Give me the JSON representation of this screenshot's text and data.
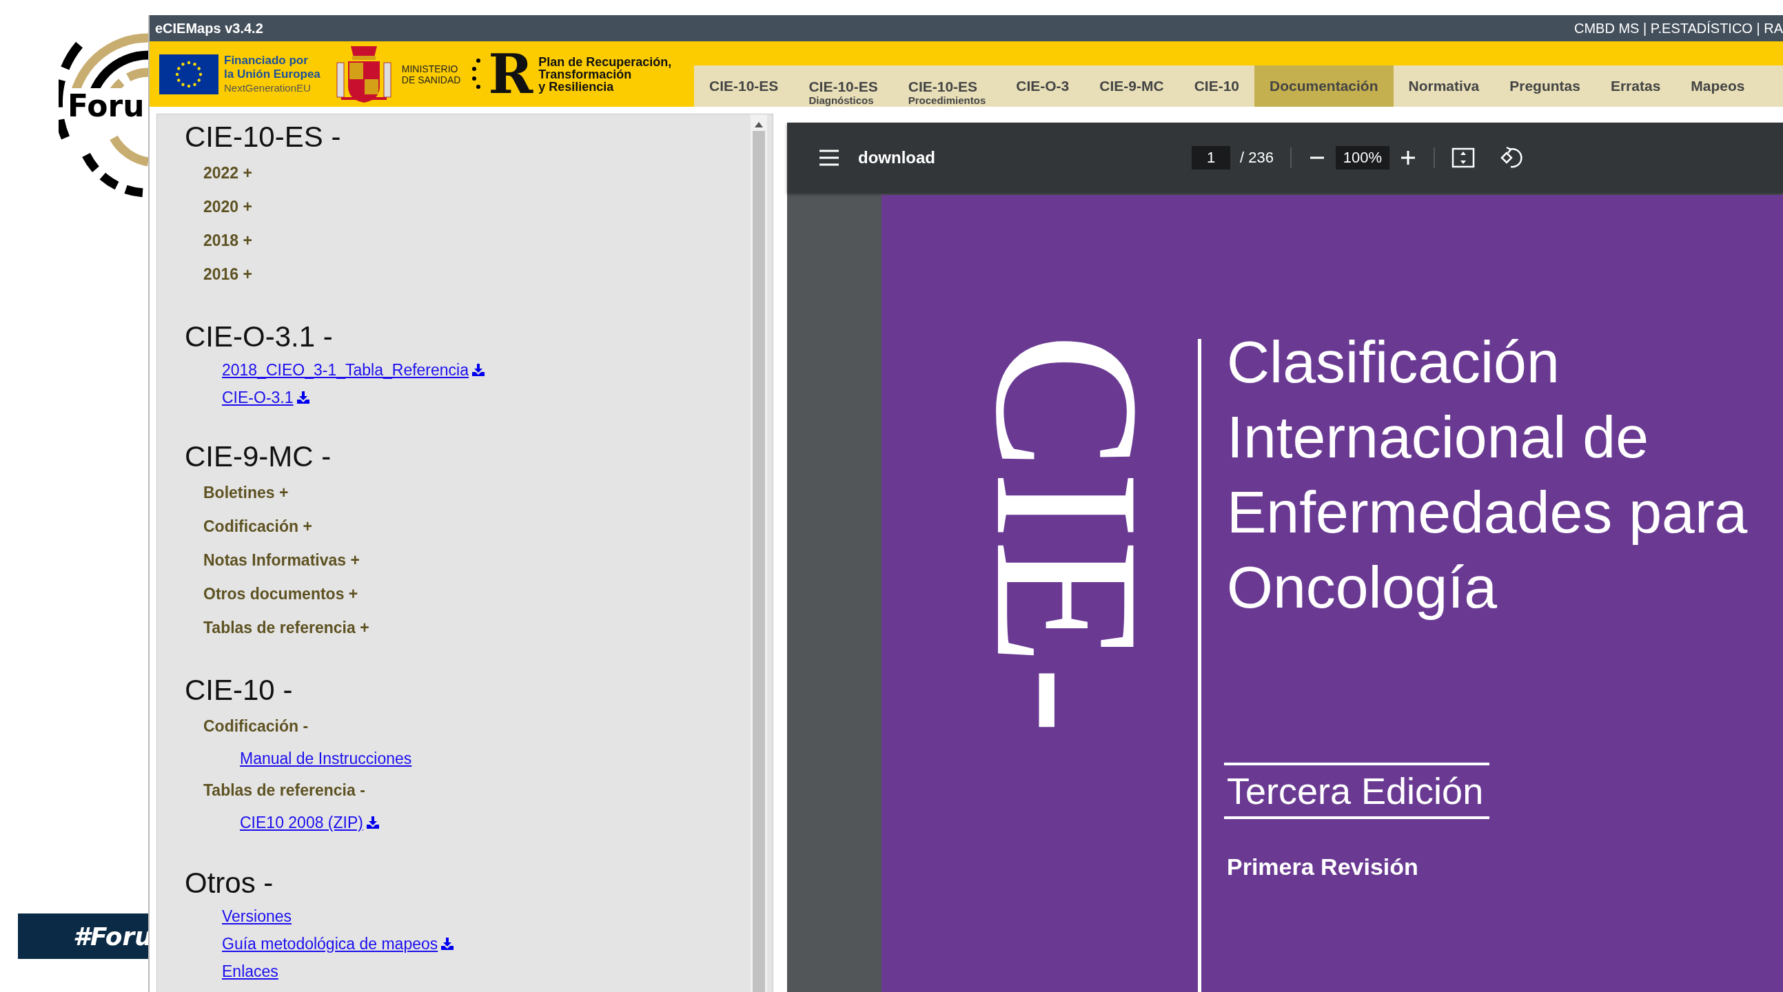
{
  "backdrop": {
    "logo_text": "Foru",
    "banner_text": "#Foru"
  },
  "window": {
    "title": "eCIEMaps v3.4.2",
    "top_links": "CMBD MS | P.ESTADÍSTICO | RA"
  },
  "header": {
    "eu_lines": [
      "Financiado por",
      "la Unión Europea"
    ],
    "eu_program": "NextGenerationEU",
    "ministry_lines": [
      "MINISTERIO",
      "DE SANIDAD"
    ],
    "plan_mark": "R",
    "plan_lines": [
      "Plan de Recuperación,",
      "Transformación",
      "y Resiliencia"
    ]
  },
  "tabs": [
    {
      "label": "CIE-10-ES",
      "selected": false
    },
    {
      "label": "CIE-10-ES",
      "sublabel": "Diagnósticos",
      "selected": false
    },
    {
      "label": "CIE-10-ES",
      "sublabel": "Procedimientos",
      "selected": false
    },
    {
      "label": "CIE-O-3",
      "selected": false
    },
    {
      "label": "CIE-9-MC",
      "selected": false
    },
    {
      "label": "CIE-10",
      "selected": false
    },
    {
      "label": "Documentación",
      "selected": true
    },
    {
      "label": "Normativa",
      "selected": false
    },
    {
      "label": "Preguntas",
      "selected": false
    },
    {
      "label": "Erratas",
      "selected": false
    },
    {
      "label": "Mapeos",
      "selected": false
    }
  ],
  "sections": [
    {
      "title": "CIE-10-ES -",
      "items": [
        {
          "kind": "group",
          "label": "2022 +"
        },
        {
          "kind": "group",
          "label": "2020 +"
        },
        {
          "kind": "group",
          "label": "2018 +"
        },
        {
          "kind": "group",
          "label": "2016 +"
        }
      ]
    },
    {
      "title": "CIE-O-3.1 -",
      "items": [
        {
          "kind": "link",
          "label": "2018_CIEO_3-1_Tabla_Referencia",
          "download": true
        },
        {
          "kind": "link",
          "label": "CIE-O-3.1",
          "download": true
        }
      ]
    },
    {
      "title": "CIE-9-MC -",
      "items": [
        {
          "kind": "group",
          "label": "Boletines +"
        },
        {
          "kind": "group",
          "label": "Codificación +"
        },
        {
          "kind": "group",
          "label": "Notas Informativas +"
        },
        {
          "kind": "group",
          "label": "Otros documentos +"
        },
        {
          "kind": "group",
          "label": "Tablas de referencia +"
        }
      ]
    },
    {
      "title": "CIE-10 -",
      "items": [
        {
          "kind": "group",
          "label": "Codificación -",
          "children": [
            {
              "kind": "link",
              "label": "Manual de Instrucciones",
              "download": false
            }
          ]
        },
        {
          "kind": "group",
          "label": "Tablas de referencia -",
          "children": [
            {
              "kind": "link",
              "label": "CIE10 2008 (ZIP)",
              "download": true
            }
          ]
        }
      ]
    },
    {
      "title": "Otros -",
      "items": [
        {
          "kind": "link",
          "label": "Versiones",
          "download": false
        },
        {
          "kind": "link",
          "label": "Guía metodológica de mapeos",
          "download": true
        },
        {
          "kind": "link",
          "label": "Enlaces",
          "download": false
        }
      ]
    }
  ],
  "pdf_viewer": {
    "file_name": "download",
    "page": "1",
    "page_total": "/ 236",
    "zoom": "100%",
    "page_content": {
      "vertical_title": "CIE-",
      "title_lines": [
        "Clasificación",
        "Internacional de",
        "Enfermedades para",
        "Oncología"
      ],
      "edition": "Tercera Edición",
      "revision": "Primera Revisión"
    }
  }
}
